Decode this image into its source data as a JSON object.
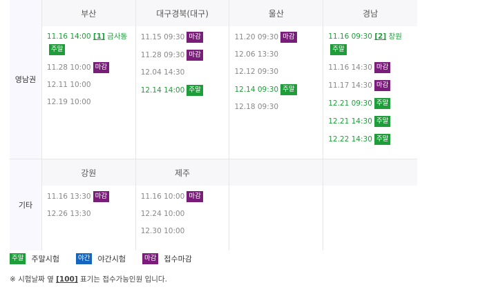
{
  "regions": [
    {
      "name": "영남권",
      "columns": [
        {
          "title": "부산",
          "entries": [
            {
              "datetime": "11.16 14:00",
              "seats": "[1]",
              "venue": "금사동",
              "weekend": true,
              "badge": "주말",
              "badge_type": "weekend",
              "badge_block": true
            },
            {
              "datetime": "11.28 10:00",
              "weekend": false,
              "badge": "마감",
              "badge_type": "closed"
            },
            {
              "datetime": "12.11 10:00",
              "weekend": false
            },
            {
              "datetime": "12.19 10:00",
              "weekend": false
            }
          ]
        },
        {
          "title": "대구경북(대구)",
          "entries": [
            {
              "datetime": "11.15 09:30",
              "weekend": false,
              "badge": "마감",
              "badge_type": "closed"
            },
            {
              "datetime": "11.28 09:30",
              "weekend": false,
              "badge": "마감",
              "badge_type": "closed"
            },
            {
              "datetime": "12.04 14:30",
              "weekend": false
            },
            {
              "datetime": "12.14 14:00",
              "weekend": true,
              "badge": "주말",
              "badge_type": "weekend"
            }
          ]
        },
        {
          "title": "울산",
          "entries": [
            {
              "datetime": "11.20 09:30",
              "weekend": false,
              "badge": "마감",
              "badge_type": "closed"
            },
            {
              "datetime": "12.06 13:30",
              "weekend": false
            },
            {
              "datetime": "12.12 09:30",
              "weekend": false
            },
            {
              "datetime": "12.14 09:30",
              "weekend": true,
              "badge": "주말",
              "badge_type": "weekend"
            },
            {
              "datetime": "12.18 09:30",
              "weekend": false
            }
          ]
        },
        {
          "title": "경남",
          "entries": [
            {
              "datetime": "11.16 09:30",
              "seats": "[2]",
              "venue": "창원",
              "weekend": true,
              "badge": "주말",
              "badge_type": "weekend",
              "badge_block": true
            },
            {
              "datetime": "11.16 14:30",
              "weekend": false,
              "badge": "마감",
              "badge_type": "closed"
            },
            {
              "datetime": "11.17 14:30",
              "weekend": false,
              "badge": "마감",
              "badge_type": "closed"
            },
            {
              "datetime": "12.21 09:30",
              "weekend": true,
              "badge": "주말",
              "badge_type": "weekend"
            },
            {
              "datetime": "12.21 14:30",
              "weekend": true,
              "badge": "주말",
              "badge_type": "weekend"
            },
            {
              "datetime": "12.22 14:30",
              "weekend": true,
              "badge": "주말",
              "badge_type": "weekend"
            }
          ]
        }
      ]
    },
    {
      "name": "기타",
      "columns": [
        {
          "title": "강원",
          "entries": [
            {
              "datetime": "11.16 13:30",
              "weekend": false,
              "badge": "마감",
              "badge_type": "closed"
            },
            {
              "datetime": "12.26 13:30",
              "weekend": false
            }
          ]
        },
        {
          "title": "제주",
          "entries": [
            {
              "datetime": "11.16 10:00",
              "weekend": false,
              "badge": "마감",
              "badge_type": "closed"
            },
            {
              "datetime": "12.24 10:00",
              "weekend": false
            },
            {
              "datetime": "12.30 10:00",
              "weekend": false
            }
          ]
        },
        {
          "title": "",
          "entries": []
        },
        {
          "title": "",
          "entries": []
        }
      ]
    }
  ],
  "legend": [
    {
      "badge": "주말",
      "badge_type": "weekend",
      "label": "주말시험"
    },
    {
      "badge": "야간",
      "badge_type": "night",
      "label": "야간시험"
    },
    {
      "badge": "마감",
      "badge_type": "closed",
      "label": "접수마감"
    }
  ],
  "note": {
    "prefix": "※ 시험날짜 옆 ",
    "seats": "[100]",
    "suffix": " 표기는 접수가능인원 입니다."
  },
  "colors": {
    "weekend": "#1f9d3a",
    "closed": "#7a1c7a",
    "night": "#1565c0",
    "region_bg": "#faf8ff",
    "header_bg": "#f7f7f9"
  }
}
